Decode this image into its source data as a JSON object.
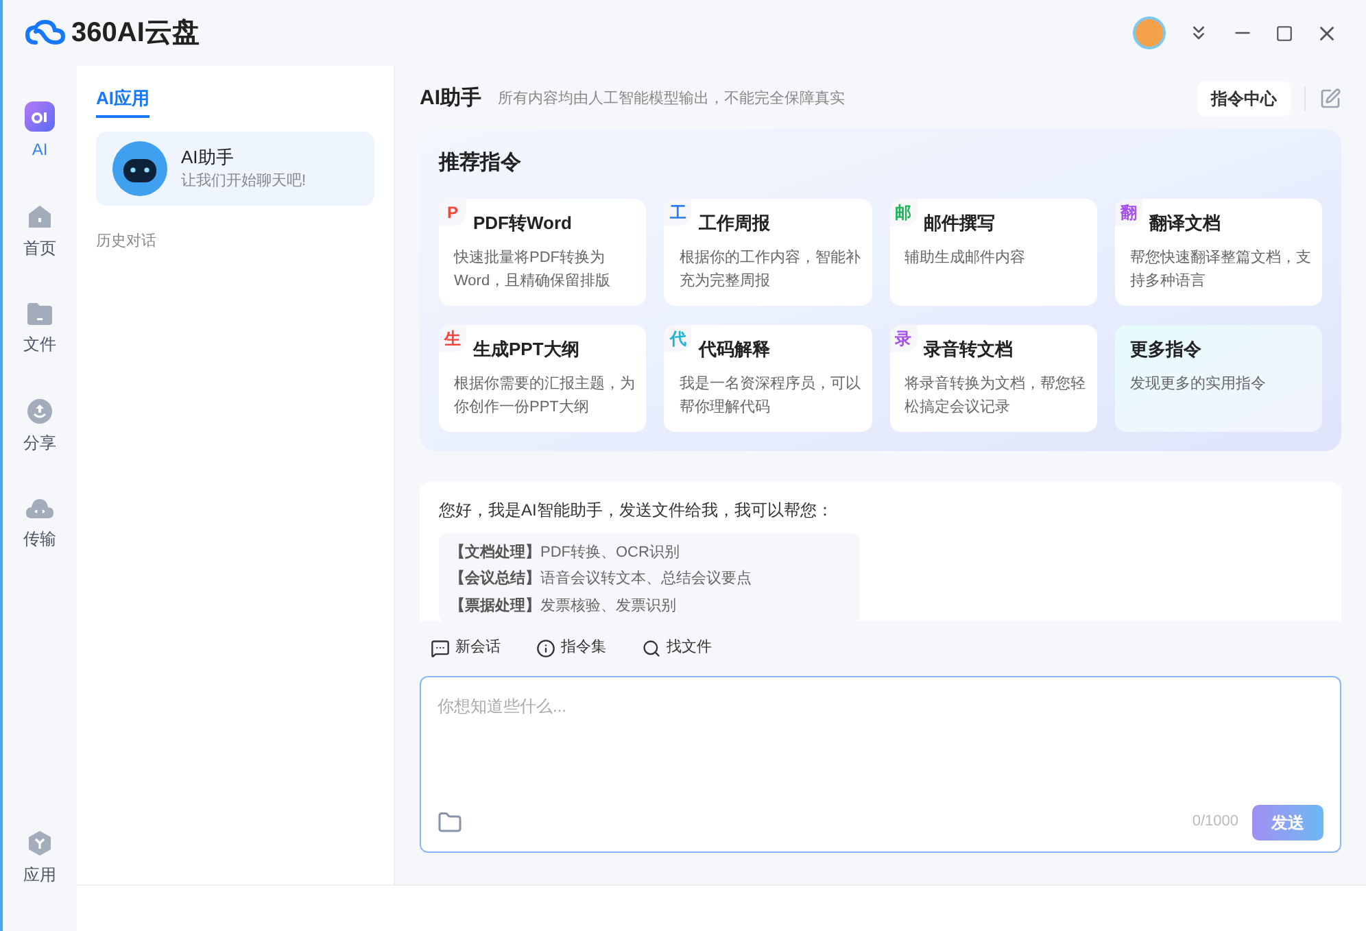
{
  "app": {
    "logo": "360AI云盘"
  },
  "nav": [
    {
      "kind": "ai",
      "label": "AI",
      "selected": true
    },
    {
      "kind": "home",
      "label": "首页",
      "selected": false
    },
    {
      "kind": "folder",
      "label": "文件",
      "selected": false
    },
    {
      "kind": "share",
      "label": "分享",
      "selected": false
    },
    {
      "kind": "transfer",
      "label": "传输",
      "selected": false
    }
  ],
  "nav_bottom": {
    "kind": "apps",
    "label": "应用",
    "selected": false
  },
  "sidebar": {
    "tab": {
      "label": "AI应用",
      "selected": true
    },
    "apps": [
      {
        "title": "AI助手",
        "subtitle": "让我们开始聊天吧!",
        "selected": true
      }
    ],
    "history_label": "历史对话"
  },
  "main": {
    "title": "AI助手",
    "subtitle": "所有内容均由人工智能模型输出，不能完全保障真实",
    "command_center": "指令中心",
    "recommend_title": "推荐指令",
    "cards": [
      {
        "kind": "command",
        "badge": "P",
        "color": "#f2473a",
        "title": "PDF转Word",
        "desc": "快速批量将PDF转换为Word，且精确保留排版"
      },
      {
        "kind": "command",
        "badge": "工",
        "color": "#2f7cf6",
        "title": "工作周报",
        "desc": "根据你的工作内容，智能补充为完整周报"
      },
      {
        "kind": "command",
        "badge": "邮",
        "color": "#1fb45a",
        "title": "邮件撰写",
        "desc": "辅助生成邮件内容"
      },
      {
        "kind": "command",
        "badge": "翻",
        "color": "#a650f0",
        "title": "翻译文档",
        "desc": "帮您快速翻译整篇文档，支持多种语言"
      },
      {
        "kind": "command",
        "badge": "生",
        "color": "#f2473a",
        "title": "生成PPT大纲",
        "desc": "根据你需要的汇报主题，为你创作一份PPT大纲"
      },
      {
        "kind": "command",
        "badge": "代",
        "color": "#22b3d6",
        "title": "代码解释",
        "desc": "我是一名资深程序员，可以帮你理解代码"
      },
      {
        "kind": "command",
        "badge": "录",
        "color": "#a650f0",
        "title": "录音转文档",
        "desc": "将录音转换为文档，帮您轻松搞定会议记录"
      },
      {
        "kind": "more",
        "title": "更多指令",
        "desc": "发现更多的实用指令"
      }
    ],
    "greeting": "您好，我是AI智能助手，发送文件给我，我可以帮您：",
    "capabilities": [
      {
        "tag": "【文档处理】",
        "text": "PDF转换、OCR识别"
      },
      {
        "tag": "【会议总结】",
        "text": "语音会议转文本、总结会议要点"
      },
      {
        "tag": "【票据处理】",
        "text": "发票核验、发票识别"
      }
    ],
    "tools": [
      {
        "kind": "chat",
        "label": "新会话"
      },
      {
        "kind": "commands",
        "label": "指令集"
      },
      {
        "kind": "search",
        "label": "找文件"
      }
    ],
    "input": {
      "placeholder": "你想知道些什么...",
      "counter": "0/1000"
    },
    "send": {
      "label": "发送",
      "disabled": true
    }
  }
}
